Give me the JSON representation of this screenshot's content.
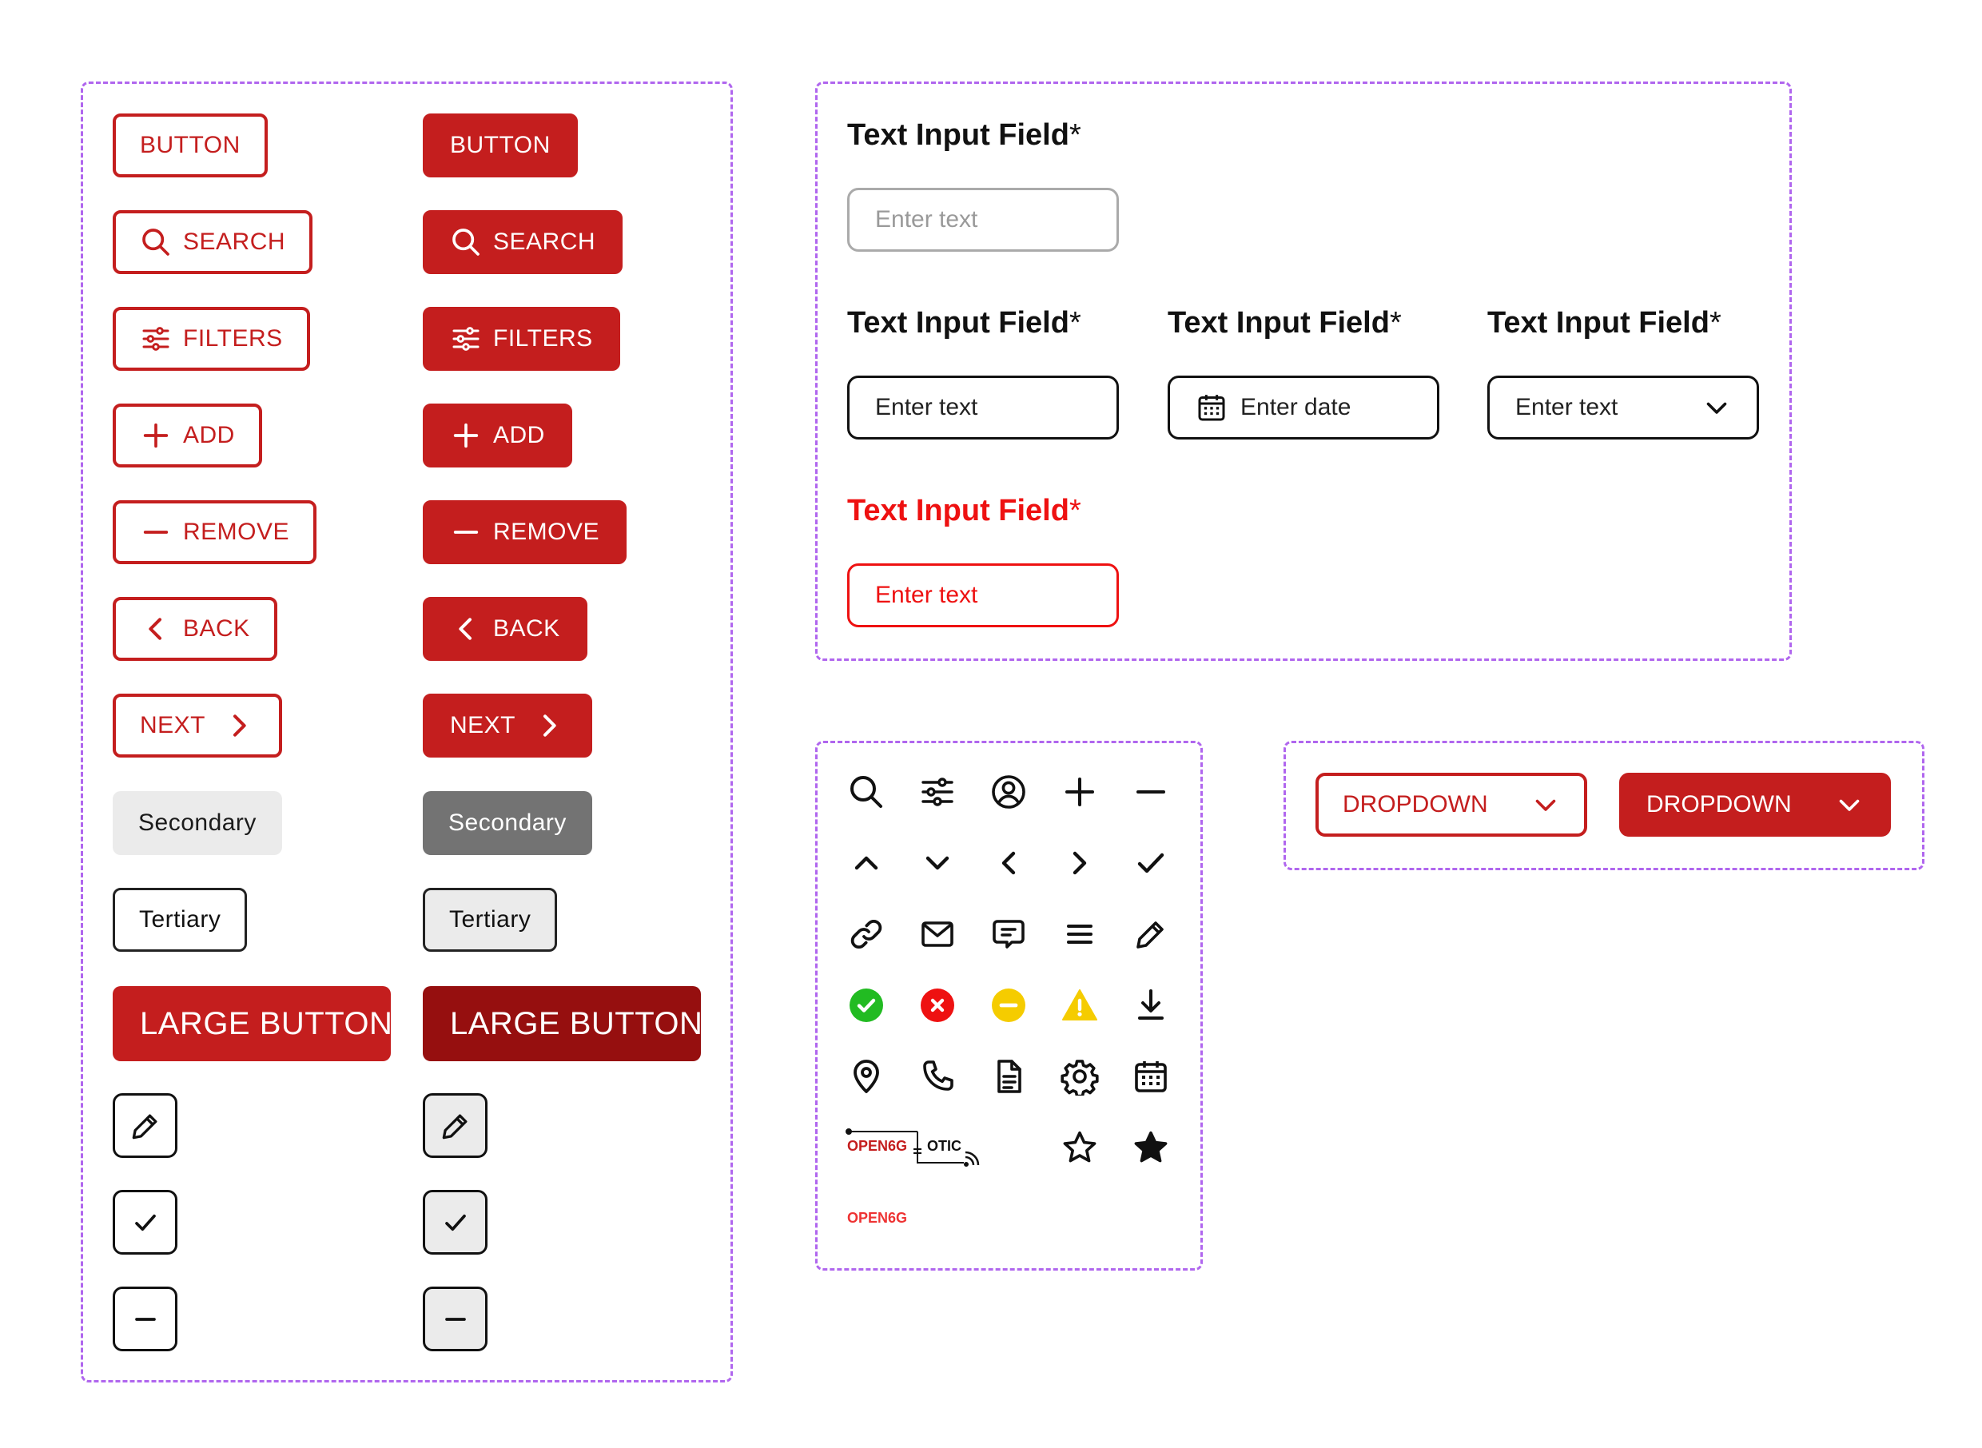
{
  "colors": {
    "primary": "#c41e1e",
    "primary_dark": "#960f0f",
    "error": "#ee1111",
    "frame": "#b066ee",
    "success": "#22bb22",
    "warning": "#f5cc00"
  },
  "buttons": {
    "button": "BUTTON",
    "search": "SEARCH",
    "filters": "FILTERS",
    "add": "ADD",
    "remove": "REMOVE",
    "back": "BACK",
    "next": "NEXT",
    "secondary": "Secondary",
    "tertiary": "Tertiary",
    "large": "LARGE BUTTON"
  },
  "inputs": {
    "label": "Text Input Field",
    "required_mark": "*",
    "placeholder_text": "Enter text",
    "placeholder_date": "Enter date"
  },
  "dropdowns": {
    "label": "DROPDOWN"
  },
  "icons": [
    "search-icon",
    "filter-icon",
    "user-icon",
    "plus-icon",
    "minus-icon",
    "chevron-up-icon",
    "chevron-down-icon",
    "chevron-left-icon",
    "chevron-right-icon",
    "check-icon",
    "link-icon",
    "mail-icon",
    "chat-icon",
    "menu-icon",
    "edit-icon",
    "success-icon",
    "error-icon",
    "neutral-icon",
    "warning-icon",
    "download-icon",
    "location-icon",
    "phone-icon",
    "document-icon",
    "settings-icon",
    "calendar-icon",
    "star-outline-icon",
    "star-filled-icon"
  ],
  "logos": {
    "logo_primary": "OPEN6G",
    "logo_secondary": "OTIC",
    "logo_small": "OPEN6G"
  }
}
